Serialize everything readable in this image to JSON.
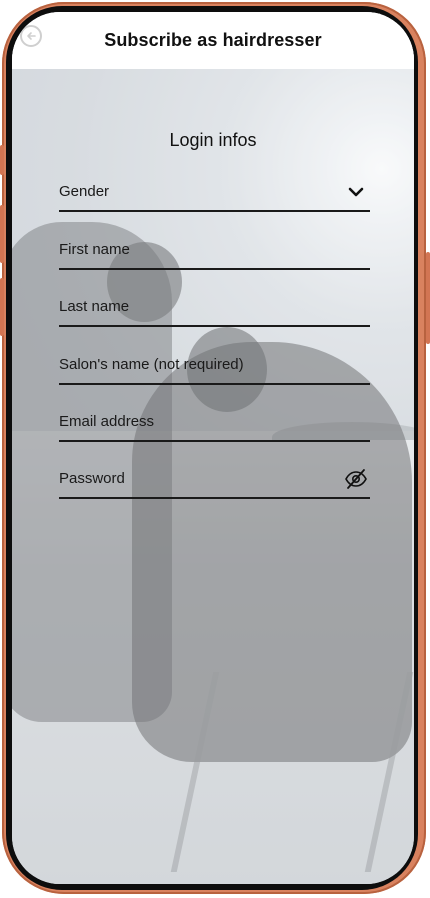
{
  "header": {
    "title": "Subscribe as hairdresser",
    "back_icon": "back-circle-icon"
  },
  "form": {
    "title": "Login infos",
    "fields": [
      {
        "label": "Gender",
        "icon": "chevron-down-icon"
      },
      {
        "label": "First name"
      },
      {
        "label": "Last name"
      },
      {
        "label": "Salon's name (not required)"
      },
      {
        "label": "Email address"
      },
      {
        "label": "Password",
        "icon": "eye-off-icon"
      }
    ]
  },
  "colors": {
    "frame": "#d9825f",
    "header_bg": "#ffffff",
    "field_line": "#1a1a1a"
  }
}
